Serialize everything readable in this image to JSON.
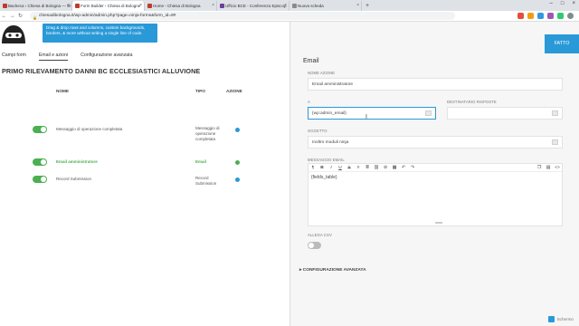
{
  "browser": {
    "tabs": [
      {
        "label": "Bacheca ‹ Chiesa di Bologna — W",
        "fav": "red"
      },
      {
        "label": "Form Builder ‹ Chiesa di Bologne",
        "fav": "red",
        "active": true
      },
      {
        "label": "Home - Chiesa di Bologna",
        "fav": "red"
      },
      {
        "label": "Ufficio BCE - Conferenza Episcop",
        "fav": "purple"
      },
      {
        "label": "Nuova scheda",
        "fav": "grey"
      }
    ],
    "url": "chiesadibologna.it/wp-admin/admin.php?page=ninja-forms&form_id=8#"
  },
  "banner": {
    "line1": "Drag & drop rows and columns, custom backgrounds,",
    "line2": "borders, & more without writing a single line of code."
  },
  "nav_tabs": [
    "Campi form",
    "Email e azioni",
    "Configurazione avanzata"
  ],
  "form_title": "PRIMO RILEVAMENTO DANNI BC ECCLESIASTICI ALLUVIONE",
  "table": {
    "headers": [
      "NOME",
      "TIPO",
      "AZIONE"
    ],
    "rows": [
      {
        "name": "Messaggio di operazione completata",
        "type": "Messaggio di operazione completata",
        "enabled": true,
        "highlight": false
      },
      {
        "name": "Email amministratore",
        "type": "Email",
        "enabled": true,
        "highlight": true
      },
      {
        "name": "Record Submission",
        "type": "Record Submission",
        "enabled": true,
        "highlight": false
      }
    ]
  },
  "panel": {
    "done_button": "FATTO",
    "title": "Email",
    "name_label": "NOME AZIONE",
    "name_value": "Email amministratore",
    "to_label": "A",
    "to_value": "{wp:admin_email}",
    "reply_label": "DESTINATARIO RISPOSTE",
    "reply_value": "",
    "subject_label": "OGGETTO",
    "subject_value": "Inoltro moduli ninja",
    "message_label": "MESSAGGIO EMAIL",
    "message_value": "{fields_table}",
    "csv_label": "ALLEGA CSV",
    "csv_enabled": false,
    "advanced_label": "CONFIGURAZIONE AVANZATA"
  },
  "status": {
    "label": "Schermo"
  },
  "colors": {
    "accent": "#2a99d8",
    "success": "#4caf50",
    "panel_bg": "#f6f6f6"
  }
}
